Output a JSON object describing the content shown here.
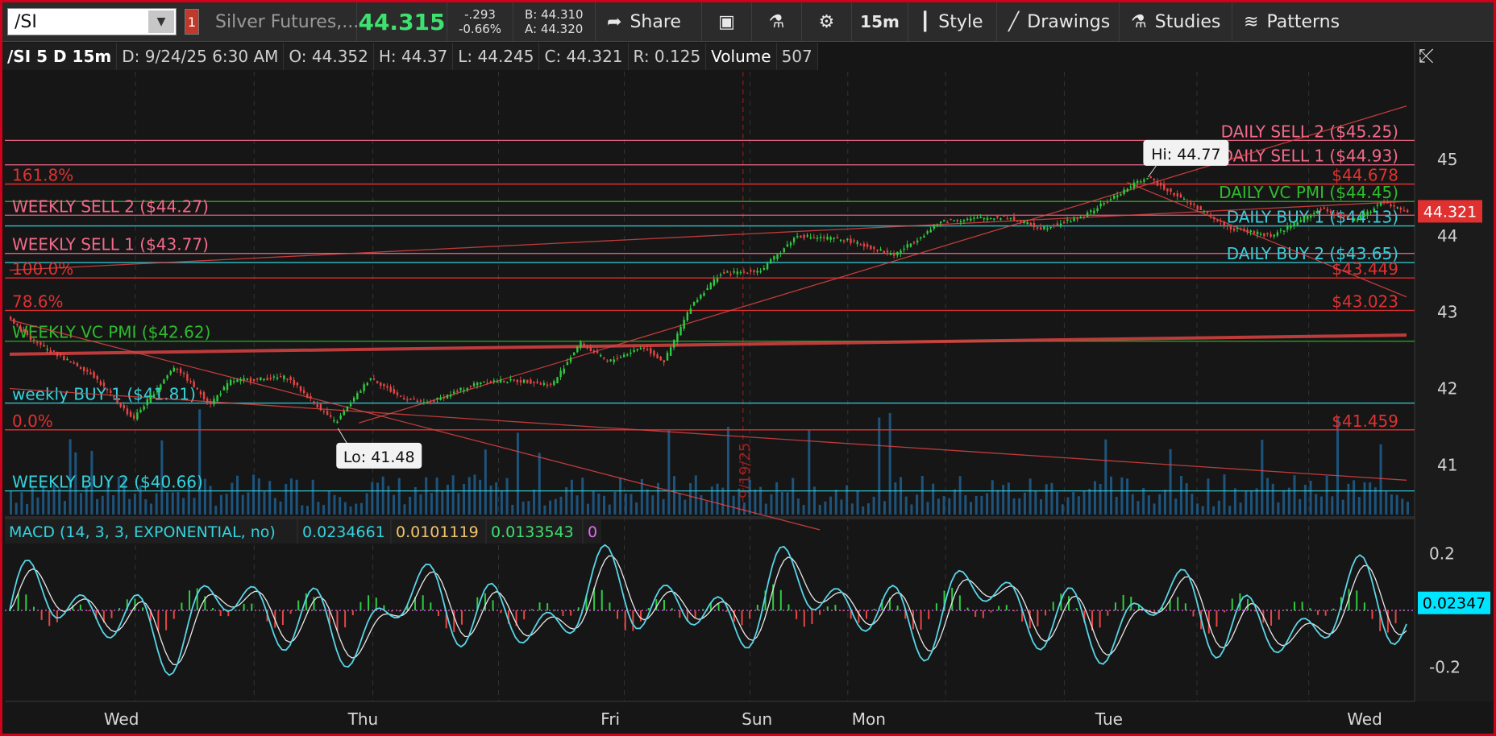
{
  "toolbar": {
    "symbol": "/SI",
    "alert_badge": "1",
    "description": "Silver Futures,...",
    "last_price": "44.315",
    "change": "-.293",
    "change_pct": "-0.66%",
    "bid": "B: 44.310",
    "ask": "A: 44.320",
    "share_label": "Share",
    "timeframe_label": "15m",
    "style_label": "Style",
    "drawings_label": "Drawings",
    "studies_label": "Studies",
    "patterns_label": "Patterns"
  },
  "info_bar": {
    "symbol_period": "/SI 5 D 15m",
    "date": "D: 9/24/25 6:30 AM",
    "open": "O: 44.352",
    "high": "H: 44.37",
    "low": "L: 44.245",
    "close": "C: 44.321",
    "range": "R: 0.125",
    "volume_label": "Volume",
    "volume_value": "507"
  },
  "price_axis": {
    "ticks": [
      45,
      44,
      43,
      42,
      41
    ],
    "current_price": "44.321",
    "current_price_value": 44.321,
    "current_price_color": "#e03131"
  },
  "x_axis": {
    "labels": [
      "Wed",
      "Thu",
      "Fri",
      "Sun",
      "Mon",
      "Tue",
      "Wed"
    ],
    "date_marker": "9/19/25"
  },
  "levels": [
    {
      "label": "DAILY SELL 2 ($45.25)",
      "price": 45.25,
      "color": "#f46a8a",
      "side": "right"
    },
    {
      "label": "DAILY SELL 1 ($44.93)",
      "price": 44.93,
      "color": "#f46a8a",
      "side": "right"
    },
    {
      "label": "$44.678",
      "price": 44.678,
      "color": "#e03131",
      "side": "right"
    },
    {
      "label": "DAILY VC PMI ($44.45)",
      "price": 44.45,
      "color": "#2dbd2d",
      "side": "right"
    },
    {
      "label": "DAILY BUY 1 ($44.13)",
      "price": 44.13,
      "color": "#34d3de",
      "side": "right"
    },
    {
      "label": "DAILY BUY 2 ($43.65)",
      "price": 43.65,
      "color": "#34d3de",
      "side": "right"
    },
    {
      "label": "$43.449",
      "price": 43.449,
      "color": "#e03131",
      "side": "right"
    },
    {
      "label": "$43.023",
      "price": 43.023,
      "color": "#e03131",
      "side": "right"
    },
    {
      "label": "$41.459",
      "price": 41.459,
      "color": "#e03131",
      "side": "right"
    },
    {
      "label": "161.8%",
      "price": 44.678,
      "color": "#e03131",
      "side": "left"
    },
    {
      "label": "WEEKLY SELL 2 ($44.27)",
      "price": 44.27,
      "color": "#f46a8a",
      "side": "left"
    },
    {
      "label": "WEEKLY SELL 1 ($43.77)",
      "price": 43.77,
      "color": "#f46a8a",
      "side": "left"
    },
    {
      "label": "100.0%",
      "price": 43.449,
      "color": "#e03131",
      "side": "left"
    },
    {
      "label": "78.6%",
      "price": 43.023,
      "color": "#e03131",
      "side": "left"
    },
    {
      "label": "WEEKLY VC PMI ($42.62)",
      "price": 42.62,
      "color": "#2dbd2d",
      "side": "left"
    },
    {
      "label": "weekly BUY 1 ($41.81)",
      "price": 41.81,
      "color": "#34d3de",
      "side": "left"
    },
    {
      "label": "0.0%",
      "price": 41.459,
      "color": "#e03131",
      "side": "left"
    },
    {
      "label": "WEEKLY BUY 2 ($40.66)",
      "price": 40.66,
      "color": "#34d3de",
      "side": "left"
    }
  ],
  "hi_label": "Hi: 44.77",
  "hi_value": 44.77,
  "lo_label": "Lo: 41.48",
  "lo_value": 41.48,
  "macd": {
    "title": "MACD (14, 3, 3, EXPONENTIAL, no)",
    "value": "0.0234661",
    "avg": "0.0101119",
    "diff": "0.0133543",
    "zero": "0",
    "axis_ticks": [
      "0.2",
      "-0.2"
    ],
    "axis_tick_values": [
      0.2,
      -0.2
    ],
    "current": "0.02347",
    "current_value": 0.02347
  },
  "colors": {
    "up": "#2ecc40",
    "down": "#e84545",
    "volume": "#1f5f8f",
    "macd_line": "#57d6e6",
    "macd_avg": "#e8e8e8"
  },
  "chart_data": {
    "type": "candlestick",
    "price_path": [
      [
        0,
        42.95
      ],
      [
        0.02,
        42.6
      ],
      [
        0.06,
        42.2
      ],
      [
        0.09,
        41.6
      ],
      [
        0.12,
        42.3
      ],
      [
        0.145,
        41.8
      ],
      [
        0.16,
        42.1
      ],
      [
        0.2,
        42.15
      ],
      [
        0.235,
        41.55
      ],
      [
        0.26,
        42.15
      ],
      [
        0.28,
        41.9
      ],
      [
        0.3,
        41.8
      ],
      [
        0.34,
        42.1
      ],
      [
        0.37,
        42.1
      ],
      [
        0.39,
        42.05
      ],
      [
        0.41,
        42.6
      ],
      [
        0.43,
        42.35
      ],
      [
        0.455,
        42.55
      ],
      [
        0.47,
        42.35
      ],
      [
        0.49,
        43.1
      ],
      [
        0.51,
        43.5
      ],
      [
        0.54,
        43.55
      ],
      [
        0.565,
        44.0
      ],
      [
        0.6,
        43.95
      ],
      [
        0.635,
        43.75
      ],
      [
        0.67,
        44.2
      ],
      [
        0.715,
        44.25
      ],
      [
        0.74,
        44.1
      ],
      [
        0.77,
        44.25
      ],
      [
        0.8,
        44.6
      ],
      [
        0.815,
        44.77
      ],
      [
        0.84,
        44.5
      ],
      [
        0.875,
        44.1
      ],
      [
        0.905,
        44.0
      ],
      [
        0.94,
        44.35
      ],
      [
        0.965,
        44.2
      ],
      [
        0.985,
        44.45
      ],
      [
        1.0,
        44.32
      ]
    ],
    "price_range": [
      40.35,
      46.15
    ],
    "macd_range": [
      -0.32,
      0.32
    ]
  }
}
